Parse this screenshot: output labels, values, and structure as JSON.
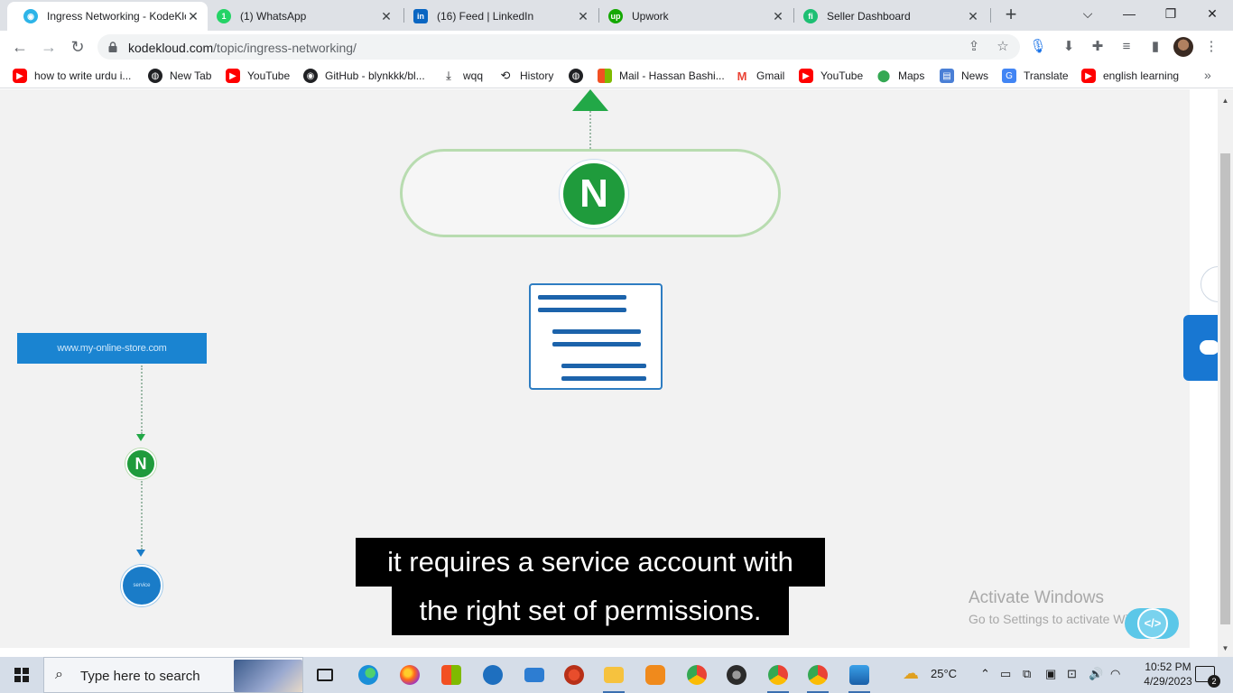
{
  "tabs": [
    {
      "title": "Ingress Networking - KodeKlo",
      "icon": "kodekloud-icon",
      "color": "#2db4e8"
    },
    {
      "title": "(1) WhatsApp",
      "icon": "whatsapp-icon",
      "color": "#25d366"
    },
    {
      "title": "(16) Feed | LinkedIn",
      "icon": "linkedin-icon",
      "color": "#0a66c2"
    },
    {
      "title": "Upwork",
      "icon": "upwork-icon",
      "color": "#14a800"
    },
    {
      "title": "Seller Dashboard",
      "icon": "fiverr-icon",
      "color": "#1dbf73"
    }
  ],
  "tab_close": "✕",
  "new_tab": "+",
  "window_controls": {
    "dropdown": "⌵",
    "minimize": "—",
    "restore": "❐",
    "close": "✕"
  },
  "address": {
    "domain": "kodekloud.com",
    "path": "/topic/ingress-networking/"
  },
  "bookmarks": [
    {
      "label": "how to write urdu i...",
      "icon": "youtube-icon"
    },
    {
      "label": "New Tab",
      "icon": "globe-icon"
    },
    {
      "label": "YouTube",
      "icon": "youtube-icon"
    },
    {
      "label": "GitHub - blynkkk/bl...",
      "icon": "github-icon"
    },
    {
      "label": "wqq",
      "icon": "download-icon"
    },
    {
      "label": "History",
      "icon": "history-icon"
    },
    {
      "label": "",
      "icon": "globe-icon"
    },
    {
      "label": "Mail - Hassan Bashi...",
      "icon": "microsoft-icon"
    },
    {
      "label": "Gmail",
      "icon": "gmail-icon"
    },
    {
      "label": "YouTube",
      "icon": "youtube-icon"
    },
    {
      "label": "Maps",
      "icon": "maps-icon"
    },
    {
      "label": "News",
      "icon": "news-icon"
    },
    {
      "label": "Translate",
      "icon": "translate-icon"
    },
    {
      "label": "english learning",
      "icon": "youtube-icon"
    }
  ],
  "bookmarks_more": "»",
  "video": {
    "nginx_letter": "N",
    "url_box_text": "www.my-online-store.com",
    "service_label": "service",
    "caption_line1": "it requires a service account with",
    "caption_line2": "the right set of permissions."
  },
  "watermark": {
    "line1": "Activate Windows",
    "line2": "Go to Settings to activate Windows."
  },
  "code_button": "</>",
  "taskbar": {
    "search_placeholder": "Type here to search",
    "temperature": "25°C",
    "time": "10:52 PM",
    "date": "4/29/2023",
    "notifications": "2"
  }
}
